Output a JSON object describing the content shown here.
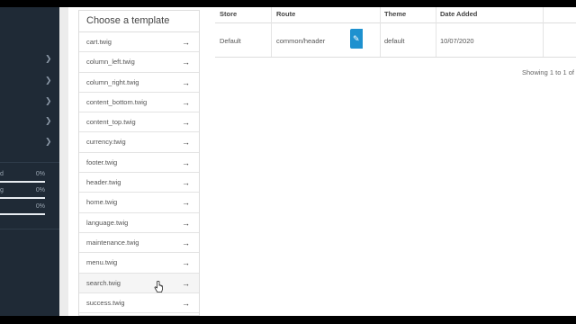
{
  "sidebar": {
    "progress": [
      {
        "letter": "d",
        "percent": "0%"
      },
      {
        "letter": "g",
        "percent": "0%"
      },
      {
        "letter": "",
        "percent": "0%"
      }
    ]
  },
  "template_panel": {
    "heading": "Choose a template",
    "items": [
      "cart.twig",
      "column_left.twig",
      "column_right.twig",
      "content_bottom.twig",
      "content_top.twig",
      "currency.twig",
      "footer.twig",
      "header.twig",
      "home.twig",
      "language.twig",
      "maintenance.twig",
      "menu.twig",
      "search.twig",
      "success.twig"
    ],
    "arrow_icon": "arrow-right-icon"
  },
  "table": {
    "headers": [
      "Store",
      "Route",
      "Theme",
      "Date Added"
    ],
    "rows": [
      {
        "store": "Default",
        "route": "common/header",
        "theme": "default",
        "date_added": "10/07/2020"
      }
    ],
    "edit_icon": "pencil-icon",
    "edit_color": "#1e91cf",
    "showing": "Showing 1 to 1 of"
  }
}
